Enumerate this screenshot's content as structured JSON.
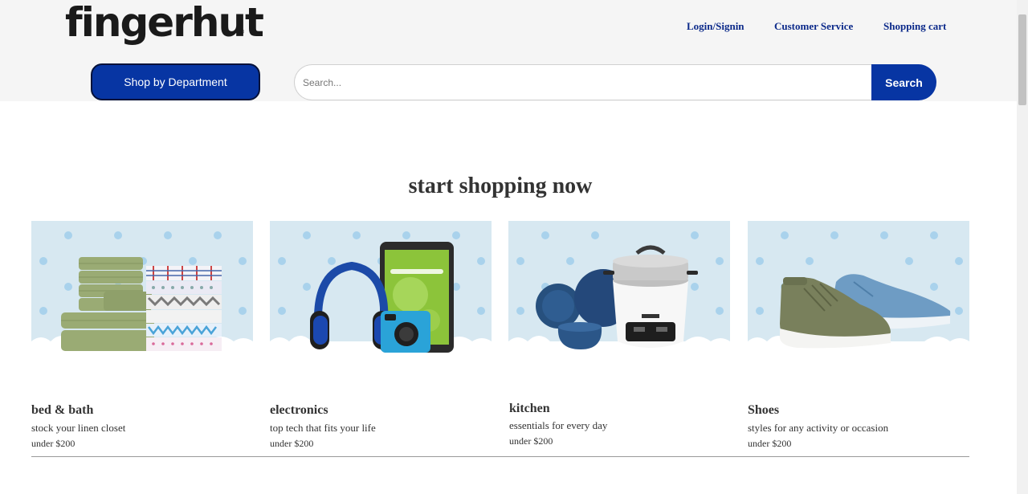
{
  "brand": {
    "name": "fingerhut",
    "mark": "®"
  },
  "nav": {
    "login": "Login/Signin",
    "service": "Customer Service",
    "cart": "Shopping cart"
  },
  "toolbar": {
    "department": "Shop by Department",
    "search_placeholder": "Search...",
    "search_button": "Search"
  },
  "headline": "start shopping now",
  "products": [
    {
      "title": "bed & bath",
      "subtitle": "stock your linen closet",
      "price": "under $200"
    },
    {
      "title": "electronics",
      "subtitle": "top tech that fits your life",
      "price": "under $200"
    },
    {
      "title": "kitchen",
      "subtitle": "essentials for every day",
      "price": "under $200"
    },
    {
      "title": "Shoes",
      "subtitle": "styles for any activity or occasion",
      "price": "under $200"
    }
  ],
  "colors": {
    "brand_blue": "#0735a3",
    "nav_link": "#0c2a8a",
    "card_bg": "#d7e8f1",
    "dot": "#a9d2ec"
  },
  "product_images": [
    "towels-and-sheets",
    "headphones-tablet-camera",
    "rice-cooker-and-dishes",
    "sneakers"
  ]
}
